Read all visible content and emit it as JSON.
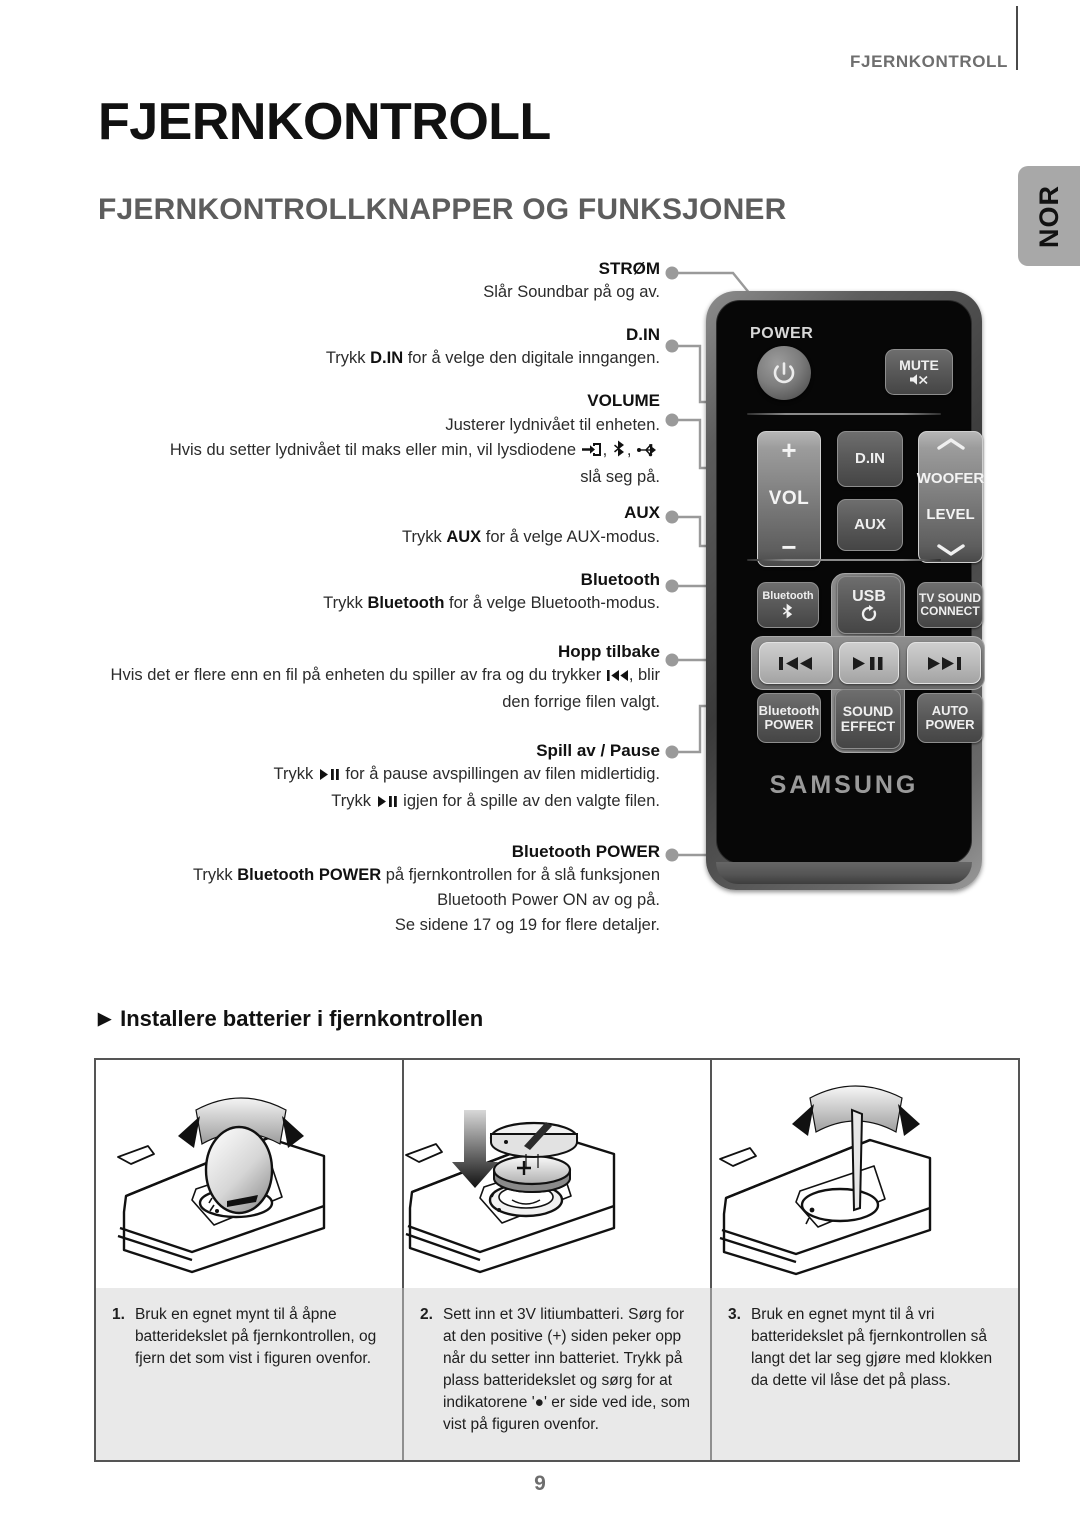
{
  "header": {
    "running_title": "FJERNKONTROLL",
    "lang_tab": "NOR"
  },
  "titles": {
    "page_title": "FJERNKONTROLL",
    "section_title": "FJERNKONTROLLKNAPPER OG FUNKSJONER"
  },
  "callouts": [
    {
      "label": "STRØM",
      "body_html": "Slår Soundbar på og av."
    },
    {
      "label": "D.IN",
      "body_html": "Trykk <b>D.IN</b> for å velge den digitale inngangen."
    },
    {
      "label": "VOLUME",
      "body_line1": "Justerer lydnivået til enheten.",
      "body_line2_pre": "Hvis du setter lydnivået til maks eller min, vil lysdiodene",
      "body_line2_post": "slå seg på.",
      "icons": [
        "d-in-icon",
        "bluetooth-icon",
        "usb-icon"
      ]
    },
    {
      "label": "AUX",
      "body_html": "Trykk <b>AUX</b> for å velge AUX-modus."
    },
    {
      "label": "Bluetooth",
      "body_html": "Trykk <b>Bluetooth</b> for å velge Bluetooth-modus."
    },
    {
      "label": "Hopp tilbake",
      "body_line1_pre": "Hvis det er flere enn en fil på enheten du spiller av fra og du trykker",
      "body_line1_post": ", blir",
      "body_line2": "den forrige filen valgt."
    },
    {
      "label": "Spill av / Pause",
      "body_line1_pre": "Trykk",
      "body_line1_post": "for å pause avspillingen av filen midlertidig.",
      "body_line2_pre": "Trykk",
      "body_line2_post": "igjen for å spille av den valgte filen."
    },
    {
      "label": "Bluetooth POWER",
      "body_line1_pre": "Trykk",
      "body_line1_bold": "Bluetooth POWER",
      "body_line1_post": "på fjernkontrollen for å slå funksjonen",
      "body_line2": "Bluetooth Power ON av og på.",
      "body_line3": "Se sidene 17 og 19 for flere detaljer."
    }
  ],
  "remote": {
    "power_word": "POWER",
    "brand": "SAMSUNG",
    "buttons": {
      "mute": "MUTE",
      "vol_plus": "+",
      "vol_label": "VOL",
      "vol_minus": "−",
      "din": "D.IN",
      "aux": "AUX",
      "woofer_line1": "WOOFER",
      "woofer_line2": "LEVEL",
      "bluetooth": "Bluetooth",
      "usb": "USB",
      "tv_sound_line1": "TV SOUND",
      "tv_sound_line2": "CONNECT",
      "bt_power_line1": "Bluetooth",
      "bt_power_line2": "POWER",
      "sound_effect_line1": "SOUND",
      "sound_effect_line2": "EFFECT",
      "auto_power_line1": "AUTO",
      "auto_power_line2": "POWER"
    }
  },
  "battery": {
    "heading_arrow": "▶",
    "heading": "Installere batterier i fjernkontrollen",
    "steps": [
      {
        "num": "1.",
        "text": "Bruk en egnet mynt til å åpne batteridekslet på fjernkontrollen, og fjern det som vist i figuren ovenfor."
      },
      {
        "num": "2.",
        "text": "Sett inn et 3V litiumbatteri. Sørg for at den positive (+) siden peker opp når du setter inn batteriet. Trykk på plass batteridekslet og sørg for at indikatorene '●' er side ved ide, som vist på figuren ovenfor."
      },
      {
        "num": "3.",
        "text": "Bruk en egnet mynt til å vri batteridekslet på fjernkontrollen så langt det lar seg gjøre med klokken da dette vil låse det på plass."
      }
    ]
  },
  "footer": {
    "page_number": "9"
  },
  "colors": {
    "accent_gray": "#6e6e6e",
    "rule": "#4a4a4a",
    "tab_bg": "#a8a8a8",
    "step_bg": "#e9e9e9",
    "remote_body": "#070707"
  }
}
